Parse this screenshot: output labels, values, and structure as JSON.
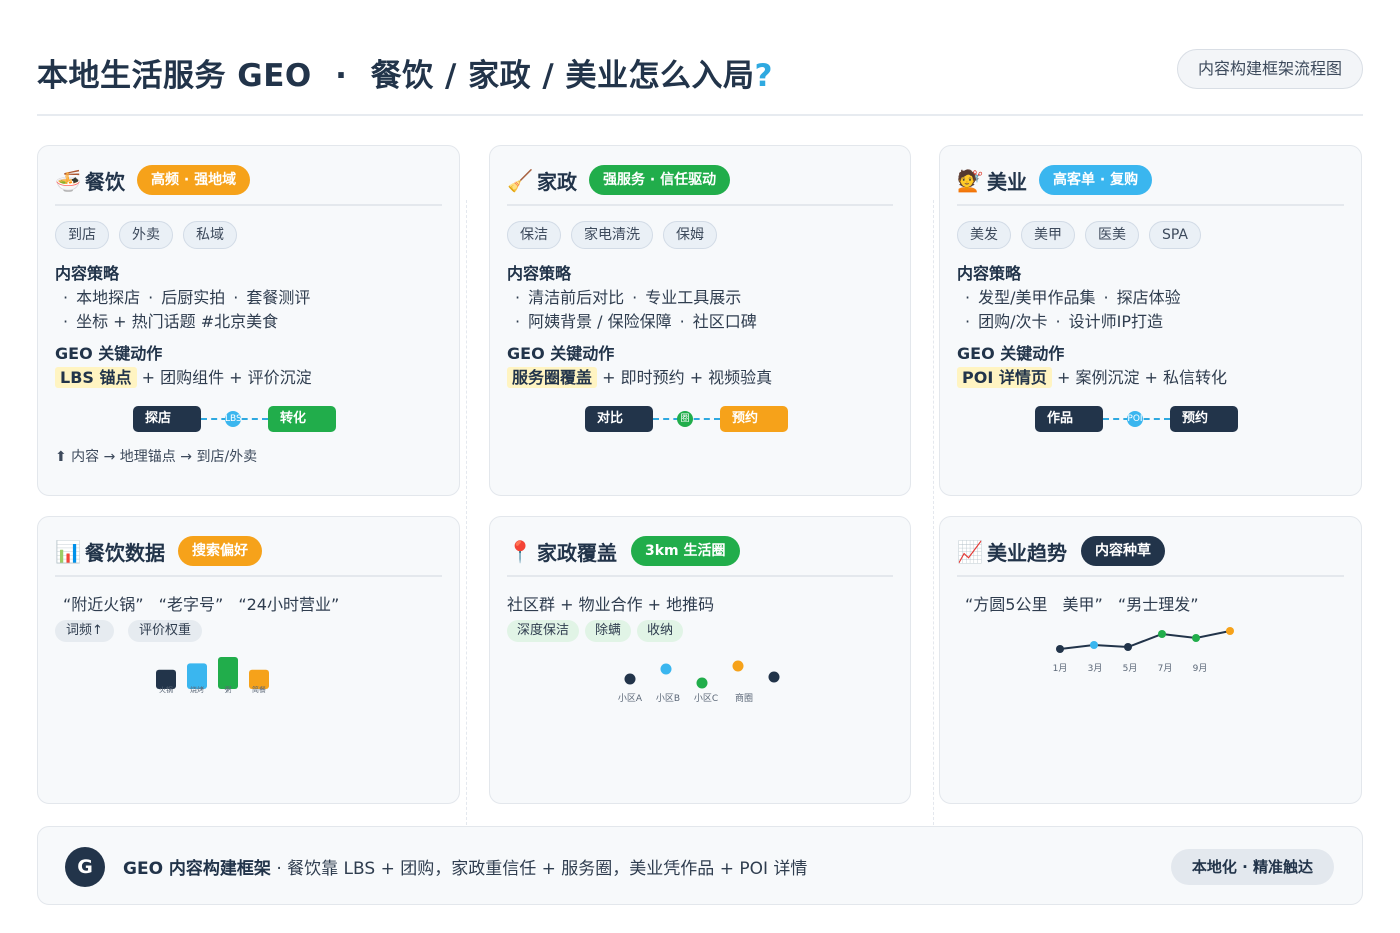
{
  "title": {
    "prefix": "本地生活服务 GEO",
    "sep": "·",
    "main": "餐饮 / 家政 / 美业怎么入局",
    "q": "?"
  },
  "header_chip": "内容构建框架流程图",
  "cards_top": [
    {
      "icon": "🍜",
      "title": "餐饮",
      "badge": "高频 · 强地域",
      "badge_color": "#f6a21a",
      "tags": [
        "到店",
        "外卖",
        "私域"
      ],
      "strategy_title": "内容策略",
      "strategy_lines": [
        [
          "本地探店",
          "后厨实拍",
          "套餐测评"
        ],
        [
          "坐标 + 热门话题 #北京美食"
        ]
      ],
      "geo_title": "GEO 关键动作",
      "geo_highlight": "LBS 锚点",
      "geo_rest": "+ 团购组件 + 评价沉淀",
      "flow": {
        "from": "探店",
        "mid": "LBS",
        "to": "转化",
        "mid_color": "#3ab6ef",
        "to_color": "#21ad4b"
      },
      "note": "⬆ 内容 → 地理锚点 → 到店/外卖"
    },
    {
      "icon": "🧹",
      "title": "家政",
      "badge": "强服务 · 信任驱动",
      "badge_color": "#21ad4b",
      "tags": [
        "保洁",
        "家电清洗",
        "保姆"
      ],
      "strategy_title": "内容策略",
      "strategy_lines": [
        [
          "清洁前后对比",
          "专业工具展示"
        ],
        [
          "阿姨背景 / 保险保障",
          "社区口碑"
        ]
      ],
      "geo_title": "GEO 关键动作",
      "geo_highlight": "服务圈覆盖",
      "geo_rest": "+ 即时预约 + 视频验真",
      "flow": {
        "from": "对比",
        "mid": "圈",
        "to": "预约",
        "mid_color": "#21ad4b",
        "to_color": "#f6a21a"
      },
      "note": ""
    },
    {
      "icon": "💇",
      "title": "美业",
      "badge": "高客单 · 复购",
      "badge_color": "#3ab6ef",
      "tags": [
        "美发",
        "美甲",
        "医美",
        "SPA"
      ],
      "strategy_title": "内容策略",
      "strategy_lines": [
        [
          "发型/美甲作品集",
          "探店体验"
        ],
        [
          "团购/次卡",
          "设计师IP打造"
        ]
      ],
      "geo_title": "GEO 关键动作",
      "geo_highlight": "POI 详情页",
      "geo_rest": "+ 案例沉淀 + 私信转化",
      "flow": {
        "from": "作品",
        "mid": "POI",
        "to": "预约",
        "mid_color": "#3ab6ef",
        "to_color": "#22344a"
      },
      "note": ""
    }
  ],
  "cards_bottom": [
    {
      "icon": "📊",
      "title": "餐饮数据",
      "badge": "搜索偏好",
      "quote": "“附近火锅”  “老字号”  “24小时营业”",
      "chips": [
        "词频↑",
        "评价权重"
      ],
      "chart_data": {
        "type": "bar",
        "categories": [
          "火锅",
          "烧烤",
          "粥",
          "简餐"
        ],
        "values": [
          3,
          4,
          5,
          3
        ],
        "colors": [
          "#22344a",
          "#3ab6ef",
          "#21ad4b",
          "#f6a21a"
        ]
      }
    },
    {
      "icon": "📍",
      "title": "家政覆盖",
      "badge": "3km 生活圈",
      "quote": "社区群 + 物业合作 + 地推码",
      "chips": [
        "深度保洁",
        "除螨",
        "收纳"
      ],
      "chart_data": {
        "type": "scatter",
        "labels": [
          "小区A",
          "小区B",
          "小区C",
          "商圈"
        ],
        "points": [
          {
            "x": 1,
            "y": 1,
            "color": "#22344a"
          },
          {
            "x": 2,
            "y": 2,
            "color": "#3ab6ef"
          },
          {
            "x": 3,
            "y": 0.6,
            "color": "#21ad4b"
          },
          {
            "x": 4,
            "y": 2.3,
            "color": "#f6a21a"
          },
          {
            "x": 5,
            "y": 1.2,
            "color": "#22344a"
          }
        ]
      }
    },
    {
      "icon": "📈",
      "title": "美业趋势",
      "badge": "内容种草",
      "quote": "“方圆5公里 美甲”  “男士理发”",
      "chips": [],
      "chart_data": {
        "type": "line",
        "x": [
          "1月",
          "",
          "3月",
          "",
          "5月",
          "",
          "7月",
          "",
          "9月",
          ""
        ],
        "values": [
          1,
          1.4,
          1.2,
          2.5,
          2.1,
          2.8
        ],
        "colors": [
          "#22344a",
          "#3ab6ef",
          "#22344a",
          "#21ad4b",
          "#21ad4b",
          "#f6a21a"
        ]
      }
    }
  ],
  "footer": {
    "logo": "G",
    "bold": "GEO 内容构建框架",
    "text": "· 餐饮靠 LBS + 团购，家政重信任 + 服务圈，美业凭作品 + POI 详情",
    "chip": "本地化 · 精准触达"
  }
}
